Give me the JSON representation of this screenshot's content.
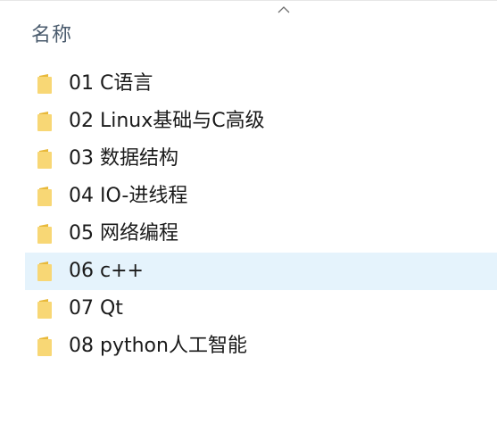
{
  "header": {
    "sort_icon": "chevron-up-icon",
    "name_column": "名称"
  },
  "colors": {
    "selected_row": "#e5f3fc",
    "folder_body": "#f8d775",
    "folder_back": "#e8b93a",
    "header_text": "#4a5b6d"
  },
  "files": [
    {
      "name": "01 C语言",
      "icon": "folder-icon",
      "selected": false
    },
    {
      "name": "02 Linux基础与C高级",
      "icon": "folder-icon",
      "selected": false
    },
    {
      "name": "03 数据结构",
      "icon": "folder-icon",
      "selected": false
    },
    {
      "name": "04 IO-进线程",
      "icon": "folder-icon",
      "selected": false
    },
    {
      "name": "05 网络编程",
      "icon": "folder-icon",
      "selected": false
    },
    {
      "name": "06 c++",
      "icon": "folder-icon",
      "selected": true
    },
    {
      "name": "07 Qt",
      "icon": "folder-icon",
      "selected": false
    },
    {
      "name": "08 python人工智能",
      "icon": "folder-icon",
      "selected": false
    }
  ]
}
